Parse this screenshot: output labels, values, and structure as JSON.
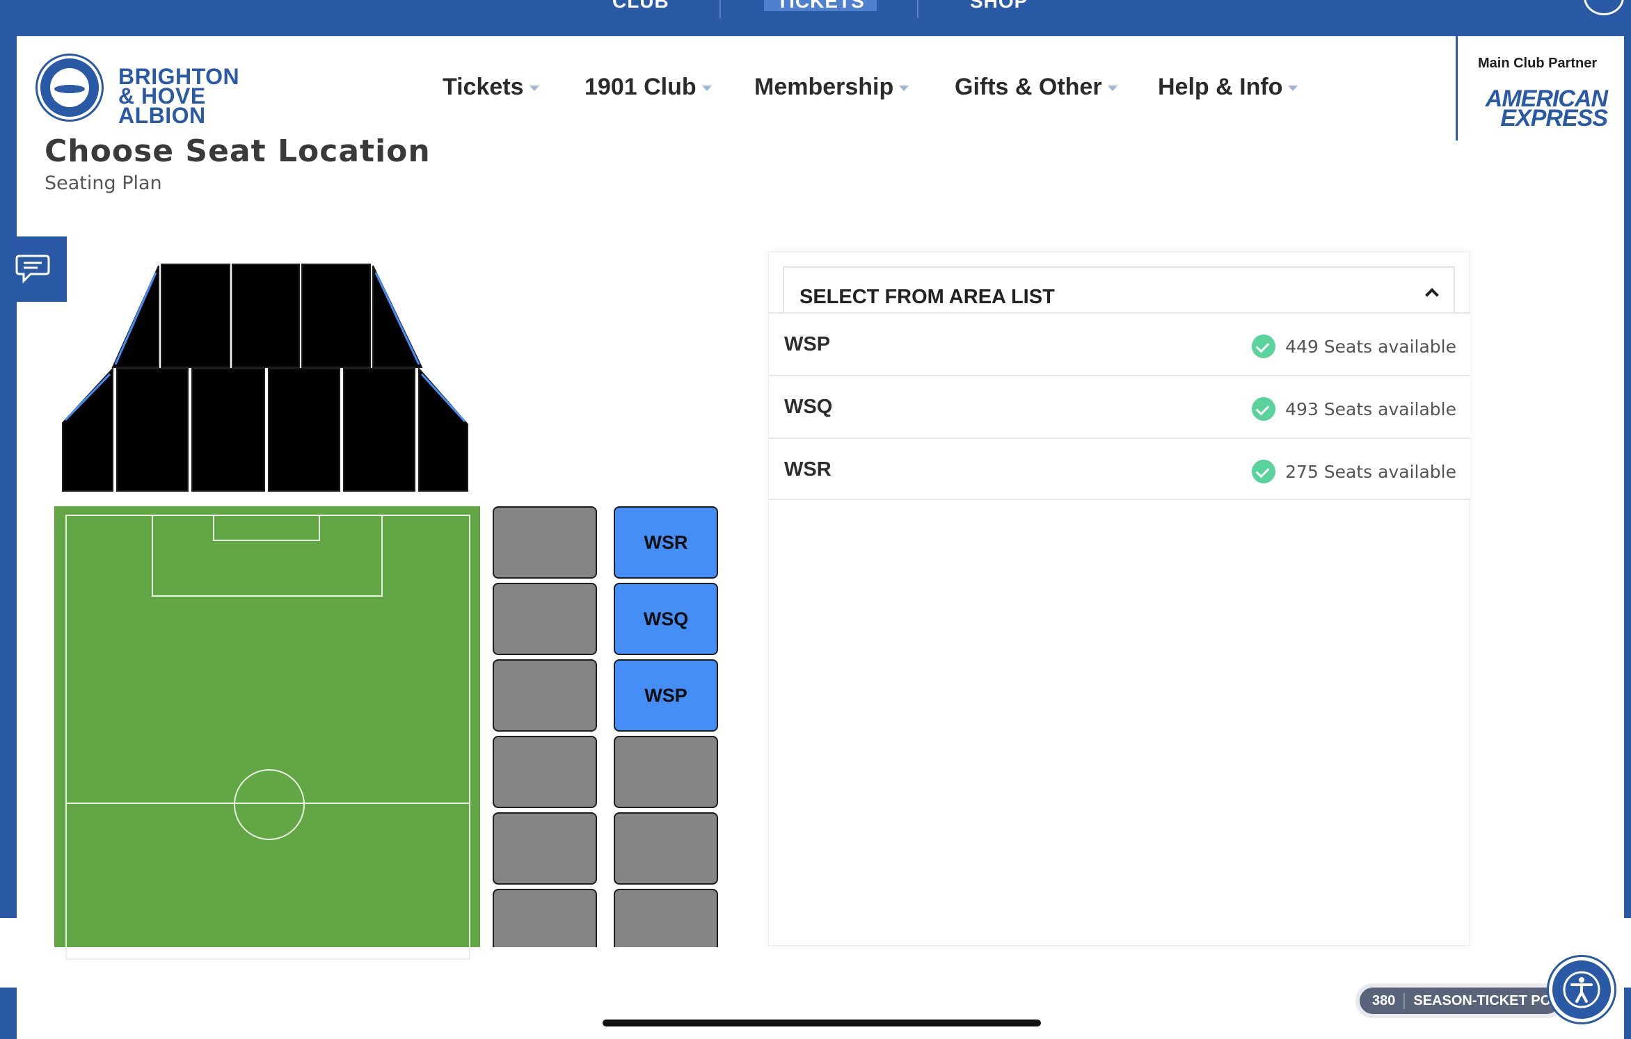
{
  "top_bar": {
    "items": [
      "CLUB",
      "TICKETS",
      "SHOP"
    ],
    "active": "TICKETS"
  },
  "header": {
    "brand_line1": "BRIGHTON",
    "brand_line2": "& HOVE ALBION",
    "nav": [
      {
        "label": "Tickets"
      },
      {
        "label": "1901 Club"
      },
      {
        "label": "Membership"
      },
      {
        "label": "Gifts & Other"
      },
      {
        "label": "Help & Info"
      }
    ],
    "partner_label": "Main Club Partner",
    "partner_line1": "AMERICAN",
    "partner_line2": "EXPRESS"
  },
  "page": {
    "title": "Choose Seat Location",
    "subtitle": "Seating Plan"
  },
  "map": {
    "available_blocks": [
      "WSR",
      "WSQ",
      "WSP"
    ]
  },
  "area_list": {
    "header": "SELECT FROM AREA LIST",
    "rows": [
      {
        "name": "WSP",
        "availability": "449 Seats available"
      },
      {
        "name": "WSQ",
        "availability": "493 Seats available"
      },
      {
        "name": "WSR",
        "availability": "275 Seats available"
      }
    ]
  },
  "footer": {
    "pill_number": "380",
    "pill_text": "SEASON-TICKET PO"
  },
  "colors": {
    "brand_blue": "#2a5aa6",
    "available_block": "#448ef6",
    "unavailable_block": "#858585",
    "pitch": "#63a645",
    "availability_check": "#59d39b"
  }
}
